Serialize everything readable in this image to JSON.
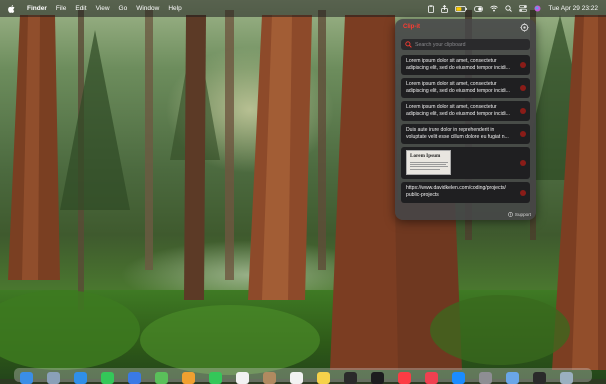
{
  "menubar": {
    "app": "Finder",
    "menus": [
      "File",
      "Edit",
      "View",
      "Go",
      "Window",
      "Help"
    ],
    "datetime": "Tue Apr 29  23:22"
  },
  "clipboard": {
    "app_name": "Clip-it",
    "search_placeholder": "Search your clipboard",
    "items": [
      "Lorem ipsum dolor sit amet, consectetur adipiscing elit, sed do eiusmod tempor incidi...",
      "Lorem ipsum dolor sit amet, consectetur adipiscing elit, sed do eiusmod tempor incidi...",
      "Lorem ipsum dolor sit amet, consectetur adipiscing elit, sed do eiusmod tempor incidi...",
      "Duis aute irure dolor in reprehenderit in voluptate velit esse cillum dolore eu fugiat n..."
    ],
    "image_item_title": "Lorem Ipsum",
    "url_item": "https://www.davidkelen.com/coding/projects/\npublic-projects",
    "support_label": "Support",
    "accent": "#ff3b30"
  },
  "dock": {
    "icons": [
      "finder-icon",
      "launchpad-icon",
      "safari-icon",
      "messages-icon",
      "mail-icon",
      "maps-icon",
      "photos-icon",
      "facetime-icon",
      "calendar-icon",
      "contacts-icon",
      "reminders-icon",
      "notes-icon",
      "freeform-icon",
      "tv-icon",
      "music-icon",
      "news-icon",
      "appstore-icon",
      "settings-icon",
      "preview-icon",
      "terminal-icon",
      "trash-icon"
    ]
  }
}
